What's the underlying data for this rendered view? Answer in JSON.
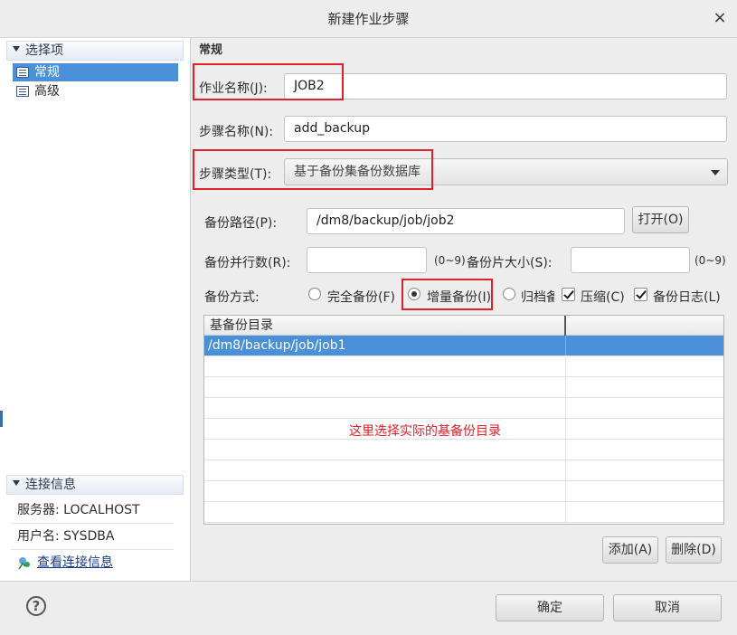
{
  "window": {
    "title": "新建作业步骤",
    "close_glyph": "×"
  },
  "left": {
    "select_header": "选择项",
    "nav_items": [
      {
        "label": "常规",
        "selected": true
      },
      {
        "label": "高级",
        "selected": false
      }
    ],
    "conn_header": "连接信息",
    "server": "服务器: LOCALHOST",
    "user": "用户名: SYSDBA",
    "view_conn": "查看连接信息"
  },
  "right": {
    "section": "常规",
    "job_name_label": "作业名称(J):",
    "job_name_value": "JOB2",
    "step_name_label": "步骤名称(N):",
    "step_name_value": "add_backup",
    "step_type_label": "步骤类型(T):",
    "step_type_value": "基于备份集备份数据库",
    "backup_path_label": "备份路径(P):",
    "backup_path_value": "/dm8/backup/job/job2",
    "open_button": "打开(O)",
    "parallel_label": "备份并行数(R):",
    "parallel_value": "",
    "parallel_range": "(0~9)",
    "piece_size_label": "备份片大小(S):",
    "piece_size_value": "",
    "piece_size_range": "(0~9)",
    "backup_mode_label": "备份方式:",
    "mode_full": "完全备份(F)",
    "mode_incremental": "增量备份(I)",
    "mode_archive": "归档备",
    "compress": "压缩(C)",
    "backup_log": "备份日志(L)",
    "grid_header": "基备份目录",
    "grid_rows": [
      "/dm8/backup/job/job1"
    ],
    "annotation": "这里选择实际的基备份目录",
    "add_button": "添加(A)",
    "delete_button": "删除(D)"
  },
  "footer": {
    "help_glyph": "?",
    "ok_button": "确定",
    "cancel_button": "取消"
  },
  "colors": {
    "selection": "#4a90d9",
    "highlight_box": "#e0202a"
  }
}
